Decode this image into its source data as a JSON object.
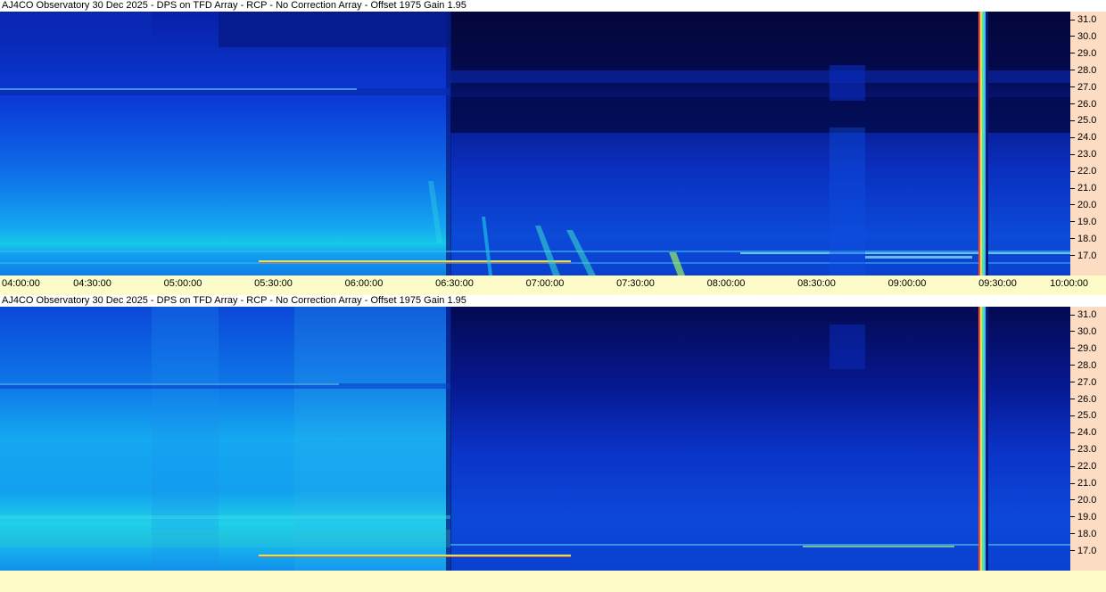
{
  "panels": [
    {
      "id": "top",
      "title": "AJ4CO Observatory 30 Dec 2025 - DPS on TFD Array  - RCP  -  No Correction Array  -  Offset 1975  Gain 1.95",
      "y_ticks": [
        "31.0",
        "30.0",
        "29.0",
        "28.0",
        "27.0",
        "26.0",
        "25.0",
        "24.0",
        "23.0",
        "22.0",
        "21.0",
        "20.0",
        "19.0",
        "18.0",
        "17.0"
      ],
      "x_ticks": [
        "04:00:00",
        "04:30:00",
        "05:00:00",
        "05:30:00",
        "06:00:00",
        "06:30:00",
        "07:00:00",
        "07:30:00",
        "08:00:00",
        "08:30:00",
        "09:00:00",
        "09:30:00",
        "10:00:00"
      ]
    },
    {
      "id": "bottom",
      "title": "AJ4CO Observatory 30 Dec 2025 - DPS on TFD Array  - RCP  -  No Correction Array  -  Offset 1975  Gain 1.95",
      "y_ticks": [
        "31.0",
        "30.0",
        "29.0",
        "28.0",
        "27.0",
        "26.0",
        "25.0",
        "24.0",
        "23.0",
        "22.0",
        "21.0",
        "20.0",
        "19.0",
        "18.0",
        "17.0"
      ],
      "x_ticks": []
    }
  ],
  "colors": {
    "y_axis_bg": "#fddcc4",
    "x_axis_bg": "#fdfbc8",
    "spectrogram_dark": "#04073a",
    "spectrogram_mid": "#0a2cc8",
    "spectrogram_bright": "#15b8f0"
  }
}
